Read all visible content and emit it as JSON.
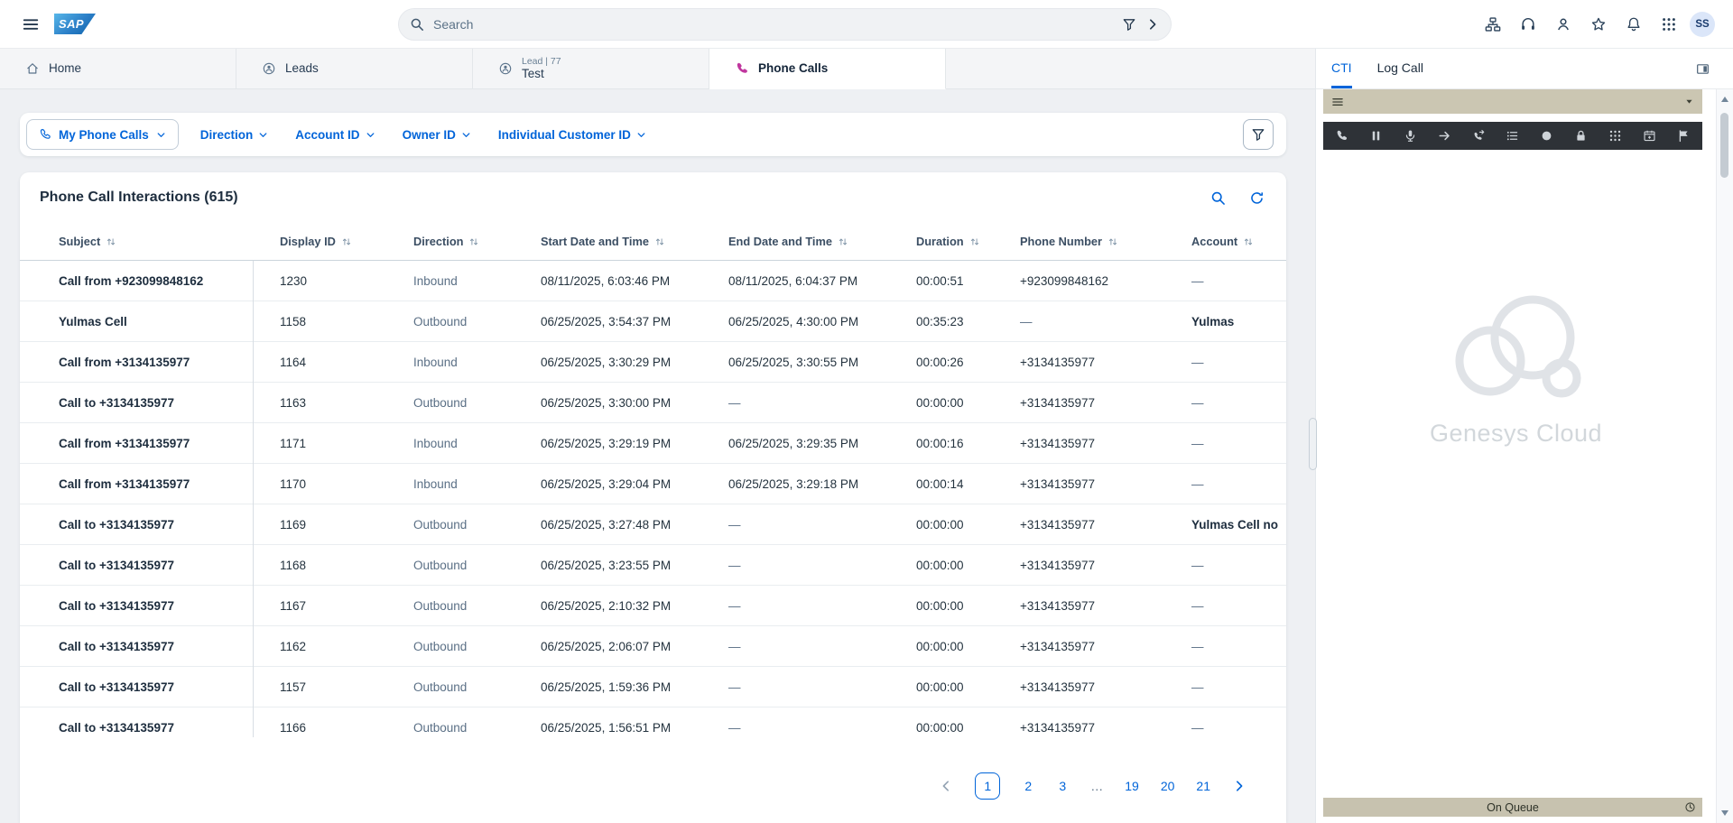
{
  "theme": {
    "accent": "#0064d9",
    "text_dark": "#1d2d3e",
    "text_muted": "#556b82",
    "phone_tab_icon": "#c0369e",
    "cti_bar": "#cbc6b2",
    "cti_toolbar": "#2e3237",
    "queue_bar": "#c7c2af"
  },
  "topbar": {
    "logo": "SAP",
    "search_placeholder": "Search",
    "avatar_initials": "SS",
    "icons": [
      "org-chart",
      "headset",
      "user-feedback",
      "favorites",
      "notifications",
      "app-launcher"
    ]
  },
  "tabs": [
    {
      "label": "Home",
      "icon": "home",
      "active": false
    },
    {
      "label": "Leads",
      "icon": "lead",
      "active": false
    },
    {
      "pretitle": "Lead | 77",
      "label": "Test",
      "icon": "lead",
      "active": false
    },
    {
      "label": "Phone Calls",
      "icon": "phone",
      "active": true
    }
  ],
  "filters": {
    "primary": {
      "label": "My Phone Calls"
    },
    "dropdowns": [
      {
        "label": "Direction"
      },
      {
        "label": "Account ID"
      },
      {
        "label": "Owner ID"
      },
      {
        "label": "Individual Customer ID"
      }
    ]
  },
  "list": {
    "title": "Phone Call Interactions (615)",
    "columns": [
      "Subject",
      "Display ID",
      "Direction",
      "Start Date and Time",
      "End Date and Time",
      "Duration",
      "Phone Number",
      "Account"
    ],
    "rows": [
      [
        "Call from +923099848162",
        "1230",
        "Inbound",
        "08/11/2025, 6:03:46 PM",
        "08/11/2025, 6:04:37 PM",
        "00:00:51",
        "+923099848162",
        "—"
      ],
      [
        "Yulmas Cell",
        "1158",
        "Outbound",
        "06/25/2025, 3:54:37 PM",
        "06/25/2025, 4:30:00 PM",
        "00:35:23",
        "—",
        "Yulmas"
      ],
      [
        "Call from +3134135977",
        "1164",
        "Inbound",
        "06/25/2025, 3:30:29 PM",
        "06/25/2025, 3:30:55 PM",
        "00:00:26",
        "+3134135977",
        "—"
      ],
      [
        "Call to +3134135977",
        "1163",
        "Outbound",
        "06/25/2025, 3:30:00 PM",
        "—",
        "00:00:00",
        "+3134135977",
        "—"
      ],
      [
        "Call from +3134135977",
        "1171",
        "Inbound",
        "06/25/2025, 3:29:19 PM",
        "06/25/2025, 3:29:35 PM",
        "00:00:16",
        "+3134135977",
        "—"
      ],
      [
        "Call from +3134135977",
        "1170",
        "Inbound",
        "06/25/2025, 3:29:04 PM",
        "06/25/2025, 3:29:18 PM",
        "00:00:14",
        "+3134135977",
        "—"
      ],
      [
        "Call to +3134135977",
        "1169",
        "Outbound",
        "06/25/2025, 3:27:48 PM",
        "—",
        "00:00:00",
        "+3134135977",
        "Yulmas Cell no"
      ],
      [
        "Call to +3134135977",
        "1168",
        "Outbound",
        "06/25/2025, 3:23:55 PM",
        "—",
        "00:00:00",
        "+3134135977",
        "—"
      ],
      [
        "Call to +3134135977",
        "1167",
        "Outbound",
        "06/25/2025, 2:10:32 PM",
        "—",
        "00:00:00",
        "+3134135977",
        "—"
      ],
      [
        "Call to +3134135977",
        "1162",
        "Outbound",
        "06/25/2025, 2:06:07 PM",
        "—",
        "00:00:00",
        "+3134135977",
        "—"
      ],
      [
        "Call to +3134135977",
        "1157",
        "Outbound",
        "06/25/2025, 1:59:36 PM",
        "—",
        "00:00:00",
        "+3134135977",
        "—"
      ],
      [
        "Call to +3134135977",
        "1166",
        "Outbound",
        "06/25/2025, 1:56:51 PM",
        "—",
        "00:00:00",
        "+3134135977",
        "—"
      ]
    ],
    "pagination": {
      "pages": [
        "1",
        "2",
        "3",
        "…",
        "19",
        "20",
        "21"
      ],
      "current": "1"
    }
  },
  "cti": {
    "tabs": [
      {
        "label": "CTI",
        "active": true
      },
      {
        "label": "Log Call",
        "active": false
      }
    ],
    "toolbar_icons": [
      "phone",
      "pause",
      "microphone",
      "forward",
      "phone-transfer",
      "call-list",
      "record",
      "lock",
      "dialpad",
      "schedule-callback",
      "flag"
    ],
    "watermark": "Genesys Cloud",
    "status_bar": "On Queue"
  }
}
